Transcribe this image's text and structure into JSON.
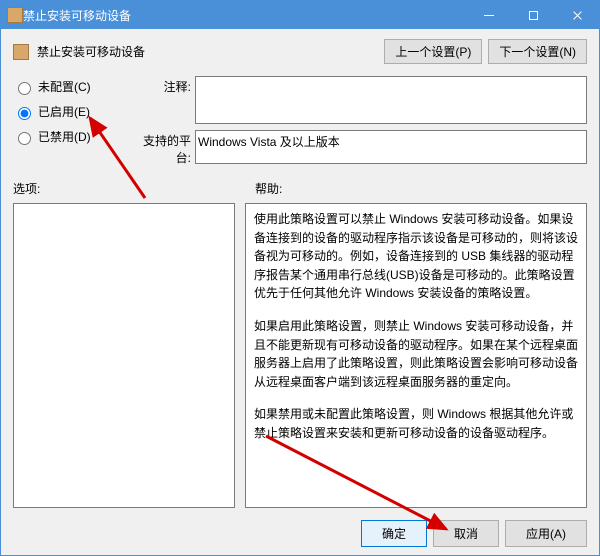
{
  "window": {
    "title": "禁止安装可移动设备"
  },
  "header": {
    "subtitle": "禁止安装可移动设备",
    "prev_btn": "上一个设置(P)",
    "next_btn": "下一个设置(N)"
  },
  "radios": {
    "not_configured": "未配置(C)",
    "enabled": "已启用(E)",
    "disabled": "已禁用(D)",
    "selected": "enabled"
  },
  "labels": {
    "comment": "注释:",
    "platform": "支持的平台:",
    "options": "选项:",
    "help": "帮助:"
  },
  "fields": {
    "comment_value": "",
    "platform_value": "Windows Vista 及以上版本"
  },
  "help": {
    "p1": "使用此策略设置可以禁止 Windows 安装可移动设备。如果设备连接到的设备的驱动程序指示该设备是可移动的，则将该设备视为可移动的。例如，设备连接到的 USB 集线器的驱动程序报告某个通用串行总线(USB)设备是可移动的。此策略设置优先于任何其他允许 Windows 安装设备的策略设置。",
    "p2": "如果启用此策略设置，则禁止 Windows 安装可移动设备，并且不能更新现有可移动设备的驱动程序。如果在某个远程桌面服务器上启用了此策略设置，则此策略设置会影响可移动设备从远程桌面客户端到该远程桌面服务器的重定向。",
    "p3": "如果禁用或未配置此策略设置，则 Windows 根据其他允许或禁止策略设置来安装和更新可移动设备的设备驱动程序。"
  },
  "footer": {
    "ok": "确定",
    "cancel": "取消",
    "apply": "应用(A)"
  }
}
